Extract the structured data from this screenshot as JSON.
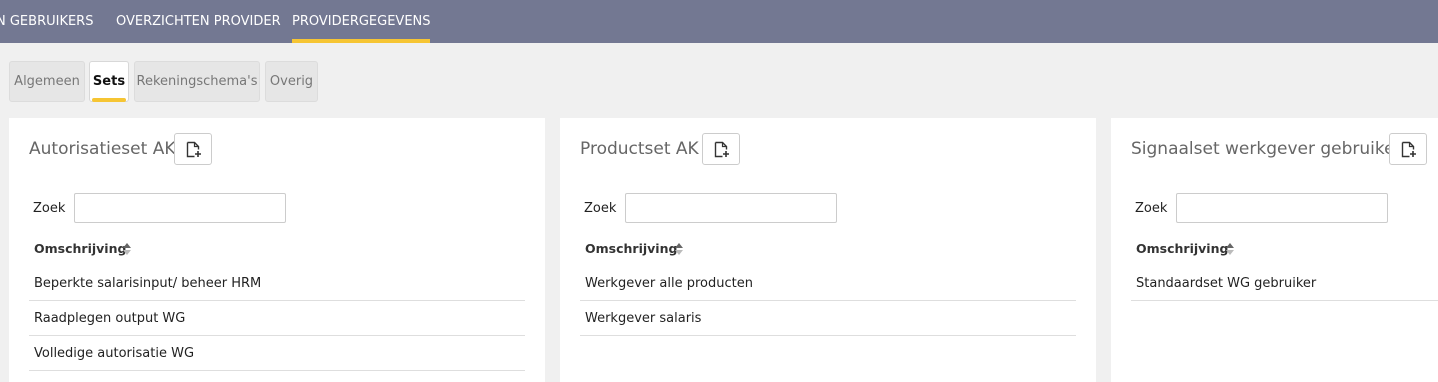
{
  "topnav": {
    "items": [
      {
        "label": "N GEBRUIKERS",
        "active": false
      },
      {
        "label": "OVERZICHTEN PROVIDER",
        "active": false
      },
      {
        "label": "PROVIDERGEGEVENS",
        "active": true
      }
    ],
    "accent": "#f6c533",
    "background": "#737892"
  },
  "subtabs": [
    {
      "label": "Algemeen",
      "active": false
    },
    {
      "label": "Sets",
      "active": true
    },
    {
      "label": "Rekeningschema's",
      "active": false
    },
    {
      "label": "Overig",
      "active": false
    }
  ],
  "panels": [
    {
      "title": "Autorisatieset AK",
      "search_label": "Zoek",
      "search_value": "",
      "column": "Omschrijving",
      "rows": [
        "Beperkte salarisinput/ beheer HRM",
        "Raadplegen output WG",
        "Volledige autorisatie WG"
      ]
    },
    {
      "title": "Productset AK",
      "search_label": "Zoek",
      "search_value": "",
      "column": "Omschrijving",
      "rows": [
        "Werkgever alle producten",
        "Werkgever salaris"
      ]
    },
    {
      "title": "Signaalset werkgever gebruiker",
      "search_label": "Zoek",
      "search_value": "",
      "column": "Omschrijving",
      "rows": [
        "Standaardset WG gebruiker"
      ]
    }
  ]
}
